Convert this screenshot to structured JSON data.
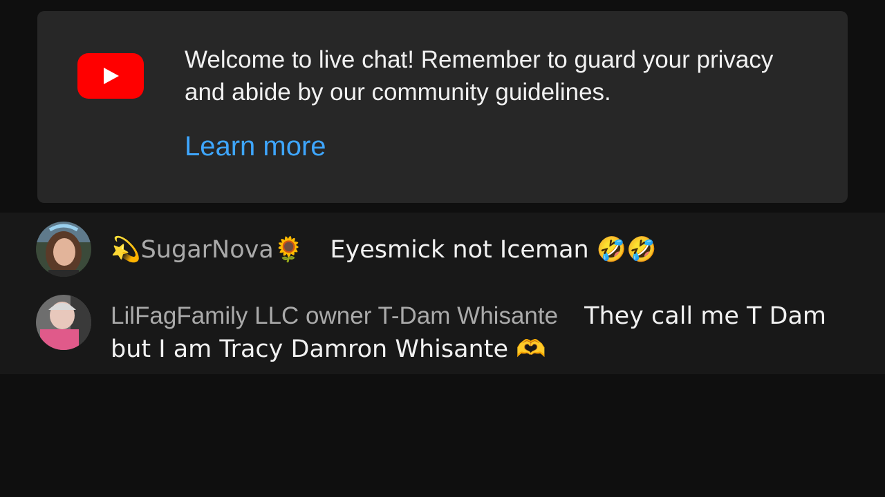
{
  "banner": {
    "text": "Welcome to live chat! Remember to guard your privacy and abide by our community guidelines.",
    "learn_more": "Learn more"
  },
  "messages": [
    {
      "author": "💫SugarNova🌻",
      "text": "Eyesmick not Iceman 🤣🤣"
    },
    {
      "author": "LilFagFamily LLC owner T-Dam Whisante",
      "text": "They call me T Dam but I am Tracy Damron Whisante 🫶"
    }
  ],
  "colors": {
    "background": "#0f0f0f",
    "banner_bg": "#272727",
    "chat_bg": "#181818",
    "link": "#3ea6ff",
    "author": "#aaaaaa",
    "text": "#f1f1f1",
    "youtube_red": "#ff0000"
  }
}
